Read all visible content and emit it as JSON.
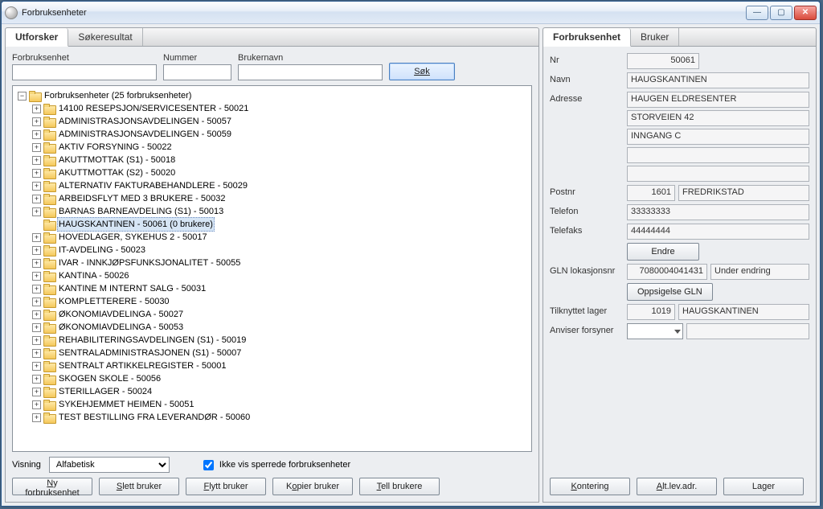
{
  "window": {
    "title": "Forbruksenheter"
  },
  "left_tabs": {
    "t1": "Utforsker",
    "t2": "Søkeresultat"
  },
  "right_tabs": {
    "t1": "Forbruksenhet",
    "t2": "Bruker"
  },
  "search": {
    "forbruksenhet_label": "Forbruksenhet",
    "nummer_label": "Nummer",
    "brukernavn_label": "Brukernavn",
    "sok_label": "Søk",
    "forbruksenhet_value": "",
    "nummer_value": "",
    "brukernavn_value": ""
  },
  "tree": {
    "root_label": "Forbruksenheter (25 forbruksenheter)",
    "items": [
      {
        "label": "14100 RESEPSJON/SERVICESENTER - 50021",
        "exp": "+"
      },
      {
        "label": "ADMINISTRASJONSAVDELINGEN - 50057",
        "exp": "+"
      },
      {
        "label": "ADMINISTRASJONSAVDELINGEN - 50059",
        "exp": "+"
      },
      {
        "label": "AKTIV FORSYNING - 50022",
        "exp": "+"
      },
      {
        "label": "AKUTTMOTTAK (S1) - 50018",
        "exp": "+"
      },
      {
        "label": "AKUTTMOTTAK (S2) - 50020",
        "exp": "+"
      },
      {
        "label": "ALTERNATIV FAKTURABEHANDLERE - 50029",
        "exp": "+"
      },
      {
        "label": "ARBEIDSFLYT MED 3 BRUKERE - 50032",
        "exp": "+"
      },
      {
        "label": "BARNAS BARNEAVDELING (S1) - 50013",
        "exp": "+"
      },
      {
        "label": "HAUGSKANTINEN - 50061 (0 brukere)",
        "exp": "",
        "selected": true
      },
      {
        "label": "HOVEDLAGER, SYKEHUS 2 - 50017",
        "exp": "+"
      },
      {
        "label": "IT-AVDELING - 50023",
        "exp": "+"
      },
      {
        "label": "IVAR - INNKJØPSFUNKSJONALITET - 50055",
        "exp": "+"
      },
      {
        "label": "KANTINA - 50026",
        "exp": "+"
      },
      {
        "label": "KANTINE M INTERNT SALG - 50031",
        "exp": "+"
      },
      {
        "label": "KOMPLETTERERE - 50030",
        "exp": "+"
      },
      {
        "label": "ØKONOMIAVDELINGA - 50027",
        "exp": "+"
      },
      {
        "label": "ØKONOMIAVDELINGA - 50053",
        "exp": "+"
      },
      {
        "label": "REHABILITERINGSAVDELINGEN (S1) - 50019",
        "exp": "+"
      },
      {
        "label": "SENTRALADMINISTRASJONEN (S1) - 50007",
        "exp": "+"
      },
      {
        "label": "SENTRALT ARTIKKELREGISTER - 50001",
        "exp": "+"
      },
      {
        "label": "SKOGEN SKOLE - 50056",
        "exp": "+"
      },
      {
        "label": "STERILLAGER - 50024",
        "exp": "+"
      },
      {
        "label": "SYKEHJEMMET HEIMEN - 50051",
        "exp": "+"
      },
      {
        "label": "TEST BESTILLING FRA LEVERANDØR - 50060",
        "exp": "+"
      }
    ]
  },
  "view": {
    "visning_label": "Visning",
    "visning_value": "Alfabetisk",
    "hide_closed_label": "Ikke vis sperrede forbruksenheter",
    "hide_closed_checked": true
  },
  "left_actions": {
    "ny": "Ny forbruksenhet",
    "slett": "Slett bruker",
    "flytt": "Flytt bruker",
    "kopier": "Kopier bruker",
    "tell": "Tell brukere"
  },
  "detail": {
    "labels": {
      "nr": "Nr",
      "navn": "Navn",
      "adresse": "Adresse",
      "postnr": "Postnr",
      "telefon": "Telefon",
      "telefaks": "Telefaks",
      "gln": "GLN lokasjonsnr",
      "tilknyttet": "Tilknyttet lager",
      "anviser": "Anviser forsyner"
    },
    "nr": "50061",
    "navn": "HAUGSKANTINEN",
    "adresse1": "HAUGEN ELDRESENTER",
    "adresse2": "STORVEIEN 42",
    "adresse3": "INNGANG C",
    "adresse4": "",
    "adresse5": "",
    "postnr": "1601",
    "poststed": "FREDRIKSTAD",
    "telefon": "33333333",
    "telefaks": "44444444",
    "endre_btn": "Endre",
    "gln": "7080004041431",
    "gln_status": "Under endring",
    "oppsigelse_btn": "Oppsigelse GLN",
    "lager_nr": "1019",
    "lager_navn": "HAUGSKANTINEN",
    "anviser_value": ""
  },
  "right_actions": {
    "kontering": "Kontering",
    "altlev": "Alt.lev.adr.",
    "lager": "Lager"
  }
}
